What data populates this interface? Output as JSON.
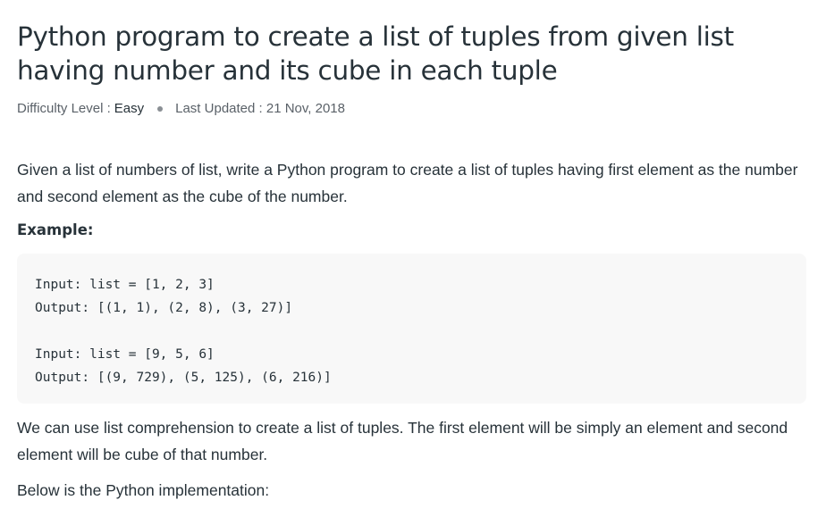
{
  "article": {
    "title": "Python program to create a list of tuples from given list having number and its cube in each tuple",
    "meta": {
      "difficulty_label": "Difficulty Level :",
      "difficulty_value": "Easy",
      "updated": "Last Updated : 21 Nov, 2018"
    },
    "intro": "Given a list of numbers of list, write a Python program to create a list of tuples having first element as the number and second element as the cube of the number.",
    "example_heading": "Example:",
    "code": {
      "line1": "Input: list = [1, 2, 3]",
      "line2": "Output: [(1, 1), (2, 8), (3, 27)]",
      "line3": "Input: list = [9, 5, 6]",
      "line4": "Output: [(9, 729), (5, 125), (6, 216)]"
    },
    "explanation": "We can use list comprehension to create a list of tuples. The first element will be simply an element and second element will be cube of that number.",
    "implementation_intro": "Below is the Python implementation:"
  }
}
